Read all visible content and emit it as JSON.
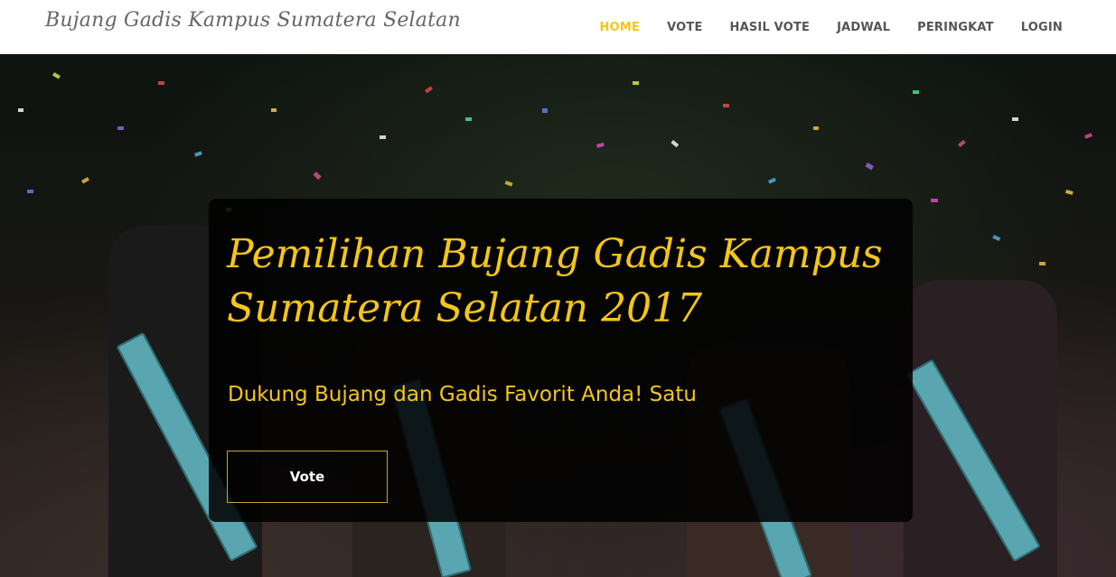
{
  "brand": "Bujang Gadis Kampus Sumatera Selatan",
  "nav": [
    {
      "label": "HOME",
      "active": true
    },
    {
      "label": "VOTE",
      "active": false
    },
    {
      "label": "HASIL VOTE",
      "active": false
    },
    {
      "label": "JADWAL",
      "active": false
    },
    {
      "label": "PERINGKAT",
      "active": false
    },
    {
      "label": "LOGIN",
      "active": false
    }
  ],
  "hero": {
    "title": "Pemilihan Bujang Gadis Kampus Sumatera Selatan 2017",
    "subtitle": "Dukung Bujang dan Gadis Favorit Anda! Satu",
    "button": "Vote"
  },
  "colors": {
    "accent": "#f5c518",
    "nav_text": "#555555",
    "brand_text": "#666666"
  }
}
